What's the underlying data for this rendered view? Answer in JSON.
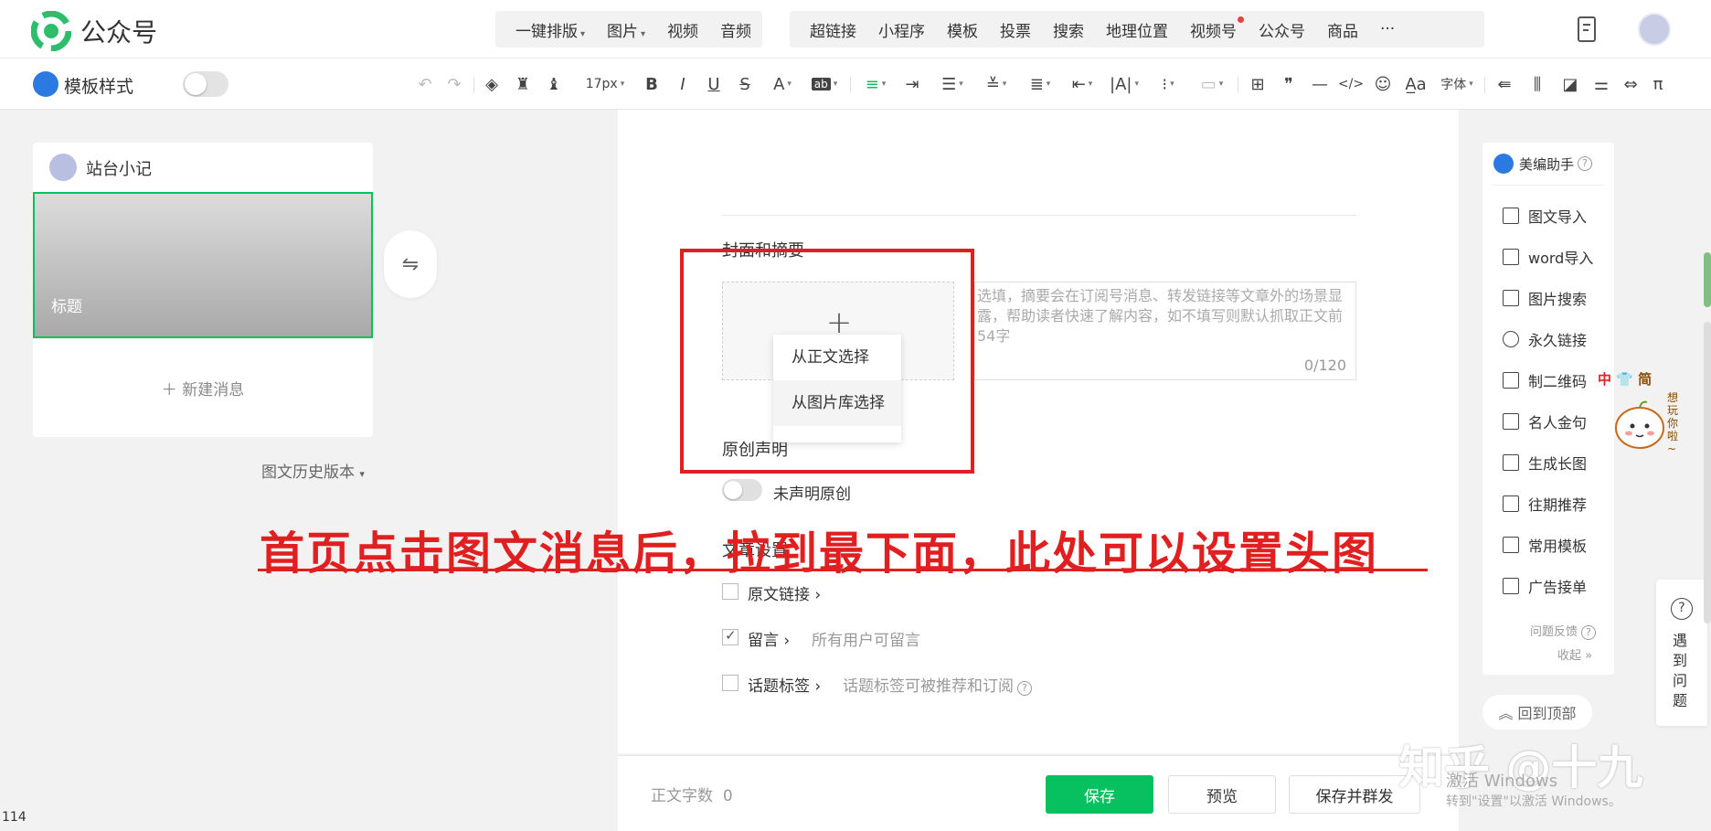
{
  "app": {
    "title": "公众号"
  },
  "top_menu": {
    "group1": [
      {
        "label": "一键排版",
        "caret": true
      },
      {
        "label": "图片",
        "caret": true
      },
      {
        "label": "视频",
        "caret": false
      },
      {
        "label": "音频",
        "caret": false
      }
    ],
    "group2": [
      {
        "label": "超链接",
        "dot": false
      },
      {
        "label": "小程序",
        "dot": false
      },
      {
        "label": "模板",
        "dot": false
      },
      {
        "label": "投票",
        "dot": false
      },
      {
        "label": "搜索",
        "dot": false
      },
      {
        "label": "地理位置",
        "dot": false
      },
      {
        "label": "视频号",
        "dot": true
      },
      {
        "label": "公众号",
        "dot": false
      },
      {
        "label": "商品",
        "dot": false
      },
      {
        "label": "···",
        "dot": false
      }
    ]
  },
  "toolbar": {
    "template_label": "模板样式",
    "font_size": "17px",
    "font_label": "字体",
    "bold": "B",
    "italic": "I",
    "underline": "U",
    "strike": "S",
    "font_color": "A",
    "bg_color": "ab",
    "quote": "❞",
    "code": "</>",
    "pi": "π"
  },
  "left_panel": {
    "account_name": "站台小记",
    "article_title": "标题",
    "new_message": "新建消息",
    "history": "图文历史版本"
  },
  "editor": {
    "cover_section_title": "封面和摘要",
    "summary_placeholder": "选填，摘要会在订阅号消息、转发链接等文章外的场景显露，帮助读者快速了解内容，如不填写则默认抓取正文前54字",
    "summary_count": "0/120",
    "cover_options": [
      "从正文选择",
      "从图片库选择"
    ],
    "original_title": "原创声明",
    "original_label": "未声明原创",
    "settings_title": "文章设置",
    "original_link": "原文链接",
    "comment_label": "留言",
    "comment_desc": "所有用户可留言",
    "topic_label": "话题标签",
    "topic_desc": "话题标签可被推荐和订阅"
  },
  "annotation": {
    "text": "首页点击图文消息后，拉到最下面，此处可以设置头图",
    "color": "#e02020"
  },
  "footer": {
    "word_count_label": "正文字数",
    "word_count": "0",
    "save": "保存",
    "preview": "预览",
    "save_send": "保存并群发"
  },
  "assistant": {
    "title": "美编助手",
    "items": [
      "图文导入",
      "word导入",
      "图片搜索",
      "永久链接",
      "制二维码",
      "名人金句",
      "生成长图",
      "往期推荐",
      "常用模板",
      "广告接单"
    ],
    "feedback": "问题反馈",
    "collapse": "收起",
    "back_to_top": "回到顶部"
  },
  "help": {
    "text": "遇到问题"
  },
  "sticker": {
    "label_a": "中",
    "label_b": "简",
    "text": "想玩你啦~"
  },
  "watermark": {
    "zhihu": "知乎 @十九",
    "windows_1": "激活 Windows",
    "windows_2": "转到\"设置\"以激活 Windows。"
  },
  "page_number": "114",
  "colors": {
    "accent": "#07c160",
    "annotation": "#e02020",
    "link_blue": "#2a7ae2"
  }
}
